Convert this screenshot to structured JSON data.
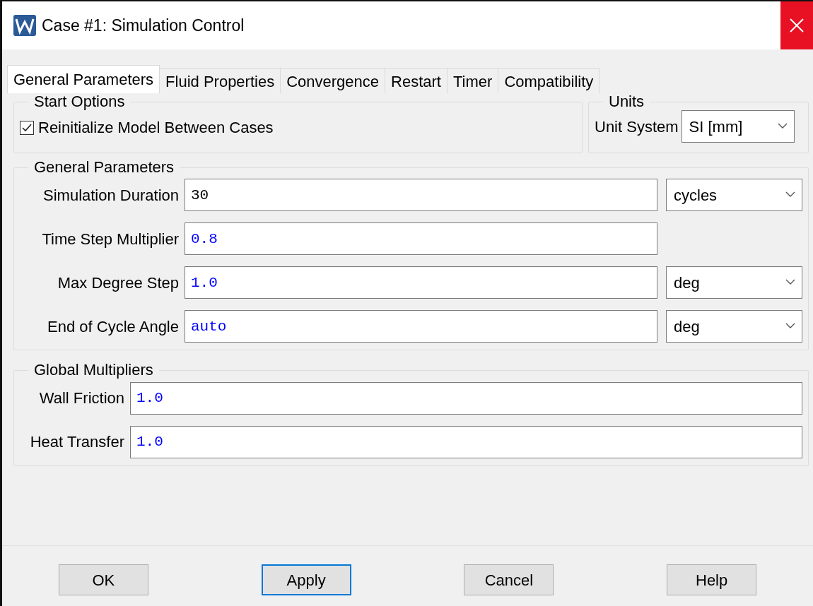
{
  "window": {
    "title": "Case #1: Simulation Control"
  },
  "tabs": [
    {
      "label": "General Parameters",
      "selected": true
    },
    {
      "label": "Fluid Properties",
      "selected": false
    },
    {
      "label": "Convergence",
      "selected": false
    },
    {
      "label": "Restart",
      "selected": false
    },
    {
      "label": "Timer",
      "selected": false
    },
    {
      "label": "Compatibility",
      "selected": false
    }
  ],
  "start_options": {
    "title": "Start Options",
    "checkbox": {
      "label": "Reinitialize Model Between Cases",
      "checked": true
    }
  },
  "units": {
    "title": "Units",
    "label": "Unit System",
    "value": "SI [mm]"
  },
  "general_parameters": {
    "title": "General Parameters",
    "fields": [
      {
        "label": "Simulation Duration",
        "value": "30",
        "color": "#000000",
        "unit": "cycles"
      },
      {
        "label": "Time Step Multiplier",
        "value": "0.8",
        "color": "#0000ff"
      },
      {
        "label": "Max Degree Step",
        "value": "1.0",
        "color": "#0000ff",
        "unit": "deg"
      },
      {
        "label": "End of Cycle Angle",
        "value": "auto",
        "color": "#0000ff",
        "unit": "deg"
      }
    ]
  },
  "global_multipliers": {
    "title": "Global Multipliers",
    "fields": [
      {
        "label": "Wall Friction",
        "value": "1.0",
        "color": "#0000ff"
      },
      {
        "label": "Heat Transfer",
        "value": "1.0",
        "color": "#0000ff"
      }
    ]
  },
  "buttons": [
    {
      "label": "OK",
      "selected": false
    },
    {
      "label": "Apply",
      "selected": true
    },
    {
      "label": "Cancel",
      "selected": false
    },
    {
      "label": "Help",
      "selected": false
    }
  ]
}
